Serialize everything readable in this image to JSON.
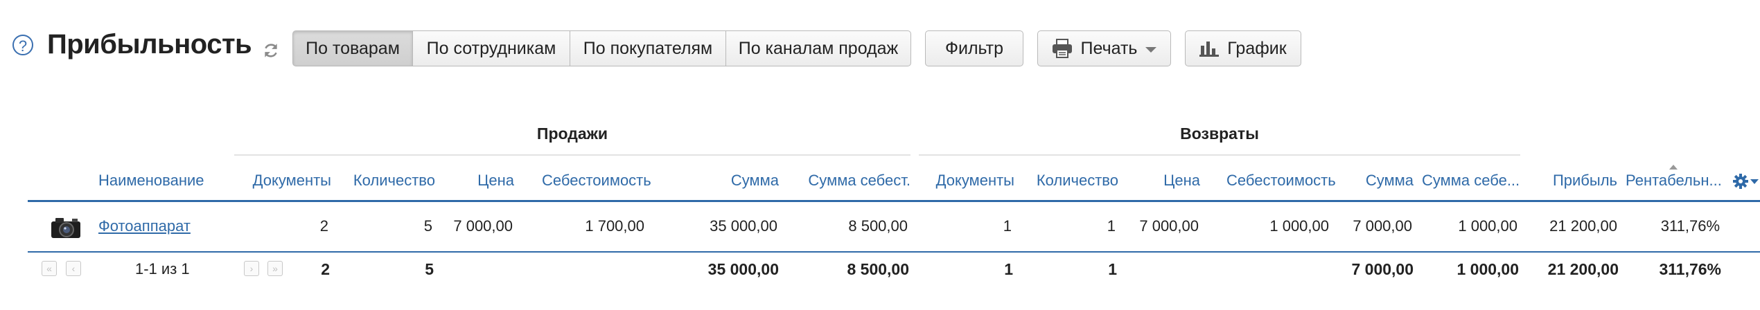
{
  "page": {
    "title": "Прибыльность",
    "help_symbol": "?"
  },
  "toolbar": {
    "tabs": [
      "По товарам",
      "По сотрудникам",
      "По покупателям",
      "По каналам продаж"
    ],
    "active_tab": "По товарам",
    "filter_label": "Фильтр",
    "print_label": "Печать",
    "chart_label": "График"
  },
  "table": {
    "groups": {
      "sales": "Продажи",
      "returns": "Возвраты"
    },
    "columns": {
      "name": "Наименование",
      "s_docs": "Документы",
      "s_qty": "Количество",
      "s_price": "Цена",
      "s_cost": "Себестоимость",
      "s_sum": "Сумма",
      "s_sumcost": "Сумма себест.",
      "r_docs": "Документы",
      "r_qty": "Количество",
      "r_price": "Цена",
      "r_cost": "Себестоимость",
      "r_sum": "Сумма",
      "r_sumcost": "Сумма себе...",
      "profit": "Прибыль",
      "margin": "Рентабельн..."
    },
    "rows": [
      {
        "name": "Фотоаппарат",
        "s_docs": "2",
        "s_qty": "5",
        "s_price": "7 000,00",
        "s_cost": "1 700,00",
        "s_sum": "35 000,00",
        "s_sumcost": "8 500,00",
        "r_docs": "1",
        "r_qty": "1",
        "r_price": "7 000,00",
        "r_cost": "1 000,00",
        "r_sum": "7 000,00",
        "r_sumcost": "1 000,00",
        "profit": "21 200,00",
        "margin": "311,76%"
      }
    ],
    "totals": {
      "pager_text": "1-1 из 1",
      "s_docs": "2",
      "s_qty": "5",
      "s_sum": "35 000,00",
      "s_sumcost": "8 500,00",
      "r_docs": "1",
      "r_qty": "1",
      "r_sum": "7 000,00",
      "r_sumcost": "1 000,00",
      "profit": "21 200,00",
      "margin": "311,76%"
    }
  },
  "icons": [
    "help-icon",
    "refresh-icon",
    "printer-icon",
    "bar-chart-icon",
    "camera-icon",
    "gear-icon",
    "pager-first-icon",
    "pager-prev-icon",
    "pager-next-icon",
    "pager-last-icon"
  ],
  "colors": {
    "link": "#2f6aa8",
    "rule": "#2f6aa8",
    "button_border": "#b9b9b9"
  }
}
